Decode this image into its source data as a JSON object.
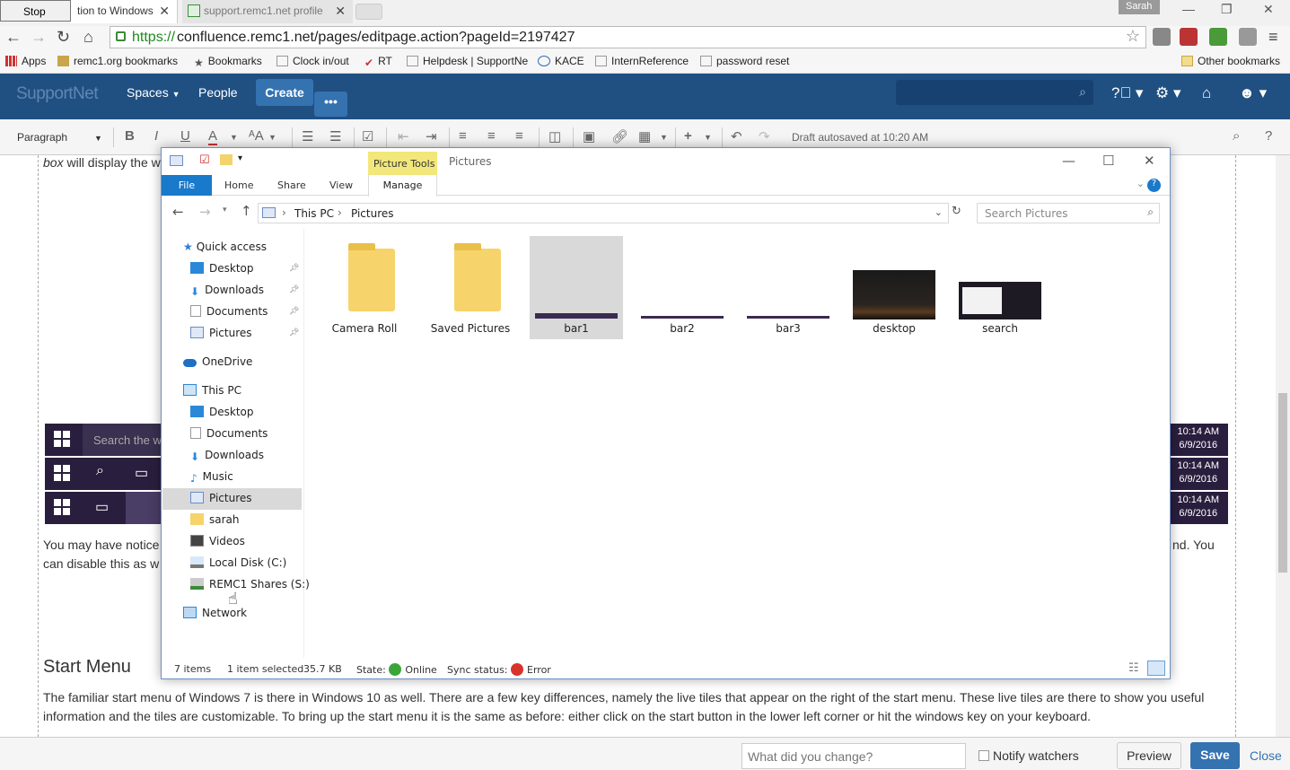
{
  "browser": {
    "stop_tooltip": "Stop",
    "tabs": [
      {
        "title": "tion to Windows"
      },
      {
        "title": "support.remc1.net profile"
      }
    ],
    "user_badge": "Sarah",
    "url_scheme": "https://",
    "url_rest": "confluence.remc1.net/pages/editpage.action?pageId=2197427",
    "bookmarks": [
      {
        "label": "Apps",
        "icon": "apps-grid-icon"
      },
      {
        "label": "remc1.org bookmarks",
        "icon": "folder-icon"
      },
      {
        "label": "Bookmarks",
        "icon": "star-icon"
      },
      {
        "label": "Clock in/out",
        "icon": "page-icon"
      },
      {
        "label": "RT",
        "icon": "checkmark-icon"
      },
      {
        "label": "Helpdesk | SupportNe",
        "icon": "page-icon"
      },
      {
        "label": "KACE",
        "icon": "dell-icon"
      },
      {
        "label": "InternReference",
        "icon": "page-icon"
      },
      {
        "label": "password reset",
        "icon": "page-icon"
      }
    ],
    "other_bookmarks": "Other bookmarks"
  },
  "confluence": {
    "logo": "SupportNet",
    "nav": {
      "spaces": "Spaces",
      "people": "People",
      "create": "Create",
      "more": "•••"
    },
    "toolbar": {
      "paragraph": "Paragraph",
      "draft_status": "Draft autosaved at 10:20 AM"
    },
    "body": {
      "top_fragment_em": "box",
      "top_fragment_rest": " will display the w",
      "search_placeholder_fragment": "Search the w",
      "clock": {
        "time": "10:14 AM",
        "date": "6/9/2016"
      },
      "notice_line1_left": "You may have notice",
      "notice_line1_right": "nd. You",
      "notice_line2_left": "can disable this as w",
      "start_menu_heading": "Start Menu",
      "start_menu_para": "The familiar start menu of Windows 7 is there in Windows 10 as well. There are a few key differences, namely the live tiles that appear on the right of the start menu. These live tiles are there to show you useful information and the tiles are customizable. To bring up the start menu it is the same as before: either click on the start button in the lower left corner or hit the windows key on your keyboard."
    },
    "bottom": {
      "change_placeholder": "What did you change?",
      "notify": "Notify watchers",
      "preview": "Preview",
      "save": "Save",
      "close": "Close"
    }
  },
  "explorer": {
    "picture_tools": "Picture Tools",
    "title": "Pictures",
    "ribbon_tabs": {
      "file": "File",
      "home": "Home",
      "share": "Share",
      "view": "View",
      "manage": "Manage"
    },
    "path": [
      "This PC",
      "Pictures"
    ],
    "search_placeholder": "Search Pictures",
    "nav": {
      "quick_access": "Quick access",
      "qa_items": [
        "Desktop",
        "Downloads",
        "Documents",
        "Pictures"
      ],
      "onedrive": "OneDrive",
      "this_pc": "This PC",
      "pc_items": [
        "Desktop",
        "Documents",
        "Downloads",
        "Music",
        "Pictures",
        "sarah",
        "Videos",
        "Local Disk (C:)",
        "REMC1 Shares (S:)"
      ],
      "network": "Network"
    },
    "files": [
      "Camera Roll",
      "Saved Pictures",
      "bar1",
      "bar2",
      "bar3",
      "desktop",
      "search"
    ],
    "status": {
      "count": "7 items",
      "selected": "1 item selected",
      "size": "35.7 KB",
      "state_label": "State:",
      "state_value": "Online",
      "sync_label": "Sync status:",
      "sync_value": "Error"
    }
  }
}
